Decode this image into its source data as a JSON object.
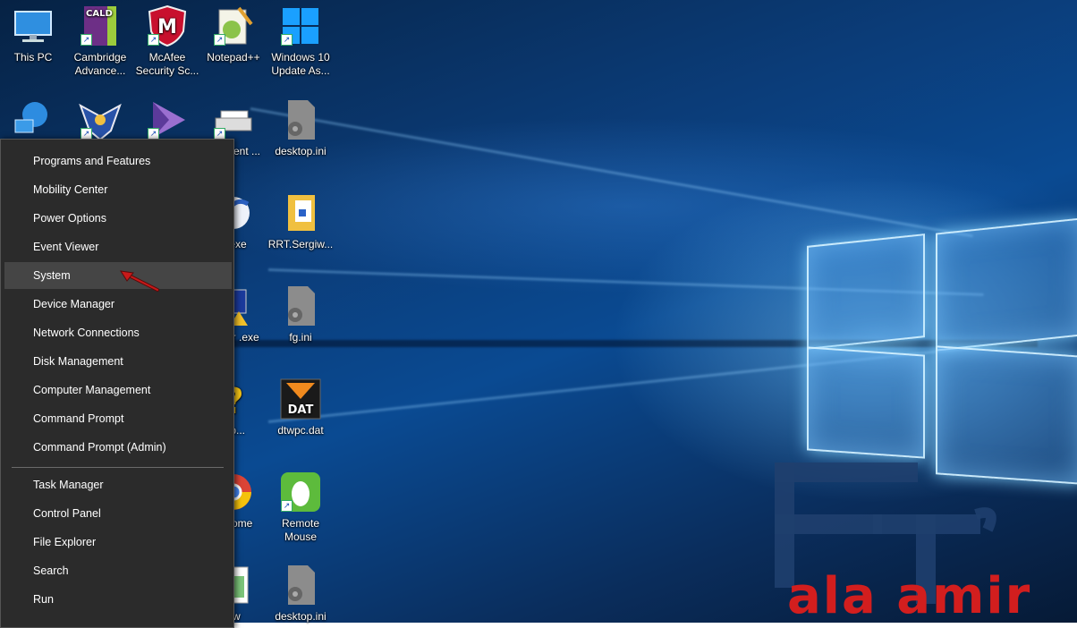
{
  "desktop_icons": [
    {
      "id": "this-pc",
      "label": "This PC",
      "icon": "computer-icon",
      "shortcut": false
    },
    {
      "id": "cambridge",
      "label": "Cambridge Advance...",
      "icon": "cambridge-book-icon",
      "shortcut": true,
      "badge": "CALD"
    },
    {
      "id": "mcafee",
      "label": "McAfee Security Sc...",
      "icon": "mcafee-shield-icon",
      "shortcut": true,
      "badge": "M"
    },
    {
      "id": "notepadpp",
      "label": "Notepad++",
      "icon": "notepad-plus-icon",
      "shortcut": true
    },
    {
      "id": "win10-update",
      "label": "Windows 10 Update As...",
      "icon": "windows-logo-icon",
      "shortcut": true
    },
    {
      "id": "network",
      "label": "",
      "icon": "network-globe-icon",
      "shortcut": false
    },
    {
      "id": "eagle",
      "label": "",
      "icon": "eagle-badge-icon",
      "shortcut": true
    },
    {
      "id": "kmplayer",
      "label": "",
      "icon": "media-player-icon",
      "shortcut": true
    },
    {
      "id": "scan",
      "label": "n a ment ...",
      "icon": "scanner-icon",
      "shortcut": true
    },
    {
      "id": "desktop-ini-1",
      "label": "desktop.ini",
      "icon": "config-file-icon",
      "shortcut": false
    },
    {
      "id": "setup-exe",
      "label": "p.exe",
      "icon": "setup-exe-icon",
      "shortcut": false
    },
    {
      "id": "rrt",
      "label": "RRT.Sergiw...",
      "icon": "folder-doc-icon",
      "shortcut": false
    },
    {
      "id": "editor-exe",
      "label": "Editor .exe",
      "icon": "editor-exe-icon",
      "shortcut": false
    },
    {
      "id": "fg-ini",
      "label": "fg.ini",
      "icon": "config-file-icon",
      "shortcut": false
    },
    {
      "id": "help",
      "label": "elp...",
      "icon": "help-icon",
      "shortcut": false
    },
    {
      "id": "dtwpc",
      "label": "dtwpc.dat",
      "icon": "dat-file-icon",
      "shortcut": false,
      "badge": "DAT"
    },
    {
      "id": "chrome",
      "label": "gle ome",
      "icon": "chrome-icon",
      "shortcut": true
    },
    {
      "id": "remote-mouse",
      "label": "Remote Mouse",
      "icon": "remote-mouse-icon",
      "shortcut": true
    },
    {
      "id": "spreadsheet",
      "label": "ew",
      "icon": "spreadsheet-icon",
      "shortcut": false
    },
    {
      "id": "desktop-ini-2",
      "label": "desktop.ini",
      "icon": "config-file-icon",
      "shortcut": false
    }
  ],
  "winx_menu": {
    "groups": [
      {
        "items": [
          {
            "label": "Programs and Features",
            "highlighted": false
          },
          {
            "label": "Mobility Center",
            "highlighted": false
          },
          {
            "label": "Power Options",
            "highlighted": false
          },
          {
            "label": "Event Viewer",
            "highlighted": false
          },
          {
            "label": "System",
            "highlighted": true
          },
          {
            "label": "Device Manager",
            "highlighted": false
          },
          {
            "label": "Network Connections",
            "highlighted": false
          },
          {
            "label": "Disk Management",
            "highlighted": false
          },
          {
            "label": "Computer Management",
            "highlighted": false
          },
          {
            "label": "Command Prompt",
            "highlighted": false
          },
          {
            "label": "Command Prompt (Admin)",
            "highlighted": false
          }
        ]
      },
      {
        "items": [
          {
            "label": "Task Manager",
            "highlighted": false
          },
          {
            "label": "Control Panel",
            "highlighted": false
          },
          {
            "label": "File Explorer",
            "highlighted": false
          },
          {
            "label": "Search",
            "highlighted": false
          },
          {
            "label": "Run",
            "highlighted": false
          }
        ]
      }
    ]
  },
  "annotation": {
    "icon": "red-arrow-icon",
    "points_to": "System",
    "color": "#c81a1a"
  },
  "watermark": {
    "letters": "FT",
    "text": "ala amir",
    "navy": "#1f3f6e",
    "red": "#d21e1e"
  },
  "colors": {
    "menu_bg": "#2b2b2b",
    "menu_highlight": "#454545",
    "menu_text": "#ffffff"
  }
}
